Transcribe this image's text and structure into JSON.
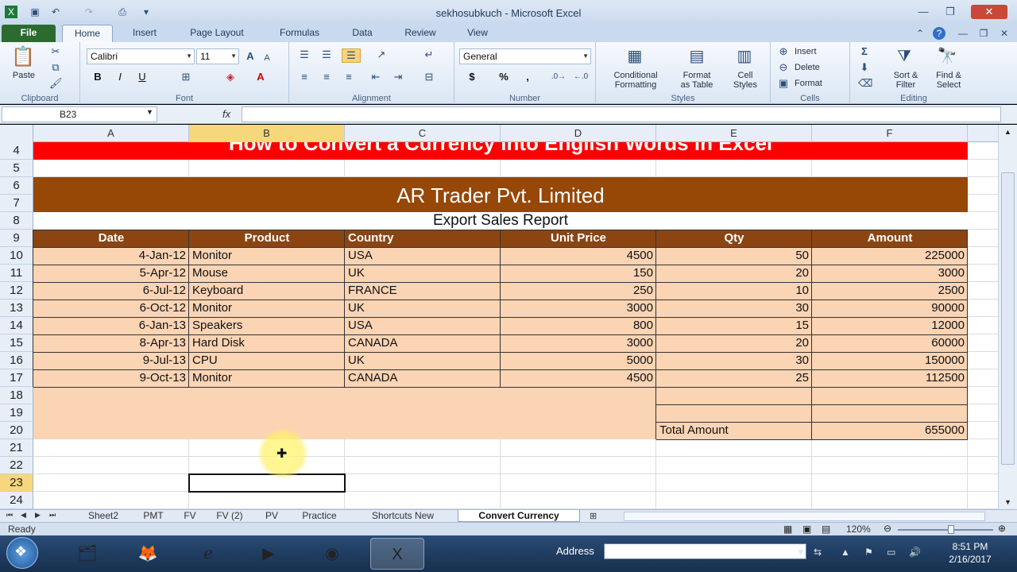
{
  "window": {
    "title": "sekhosubkuch - Microsoft Excel",
    "minimize_icon": "minimize-icon",
    "restore_icon": "restore-icon",
    "close_icon": "close-icon"
  },
  "tabs": [
    "File",
    "Home",
    "Insert",
    "Page Layout",
    "Formulas",
    "Data",
    "Review",
    "View"
  ],
  "ribbon": {
    "clipboard": {
      "label": "Clipboard",
      "paste": "Paste"
    },
    "font": {
      "label": "Font",
      "name": "Calibri",
      "size": "11",
      "bold": "B",
      "italic": "I",
      "underline": "U"
    },
    "alignment": {
      "label": "Alignment"
    },
    "number": {
      "label": "Number",
      "format": "General",
      "currency": "$",
      "percent": "%",
      "comma": ","
    },
    "styles": {
      "label": "Styles",
      "conditional_1": "Conditional",
      "conditional_2": "Formatting",
      "format_table_1": "Format",
      "format_table_2": "as Table",
      "cell_styles_1": "Cell",
      "cell_styles_2": "Styles"
    },
    "cells": {
      "label": "Cells",
      "insert": "Insert",
      "delete": "Delete",
      "format": "Format"
    },
    "editing": {
      "label": "Editing",
      "sort_1": "Sort &",
      "sort_2": "Filter",
      "find_1": "Find &",
      "find_2": "Select"
    }
  },
  "formula_bar": {
    "name_box": "B23",
    "fx": "fx",
    "formula": ""
  },
  "columns": [
    "A",
    "B",
    "C",
    "D",
    "E",
    "F"
  ],
  "rows": [
    "4",
    "5",
    "6",
    "7",
    "8",
    "9",
    "10",
    "11",
    "12",
    "13",
    "14",
    "15",
    "16",
    "17",
    "18",
    "19",
    "20",
    "21",
    "22",
    "23",
    "24"
  ],
  "sheet": {
    "banner": "How to Convert a Currency into English Words in Excel",
    "company": "AR Trader Pvt. Limited",
    "report": "Export Sales Report",
    "headers": [
      "Date",
      "Product",
      "Country",
      "Unit Price",
      "Qty",
      "Amount"
    ],
    "data": [
      [
        "4-Jan-12",
        "Monitor",
        "USA",
        "4500",
        "50",
        "225000"
      ],
      [
        "5-Apr-12",
        "Mouse",
        "UK",
        "150",
        "20",
        "3000"
      ],
      [
        "6-Jul-12",
        "Keyboard",
        "FRANCE",
        "250",
        "10",
        "2500"
      ],
      [
        "6-Oct-12",
        "Monitor",
        "UK",
        "3000",
        "30",
        "90000"
      ],
      [
        "6-Jan-13",
        "Speakers",
        "USA",
        "800",
        "15",
        "12000"
      ],
      [
        "8-Apr-13",
        "Hard Disk",
        "CANADA",
        "3000",
        "20",
        "60000"
      ],
      [
        "9-Jul-13",
        "CPU",
        "UK",
        "5000",
        "30",
        "150000"
      ],
      [
        "9-Oct-13",
        "Monitor",
        "CANADA",
        "4500",
        "25",
        "112500"
      ]
    ],
    "total_label": "Total Amount",
    "total_value": "655000"
  },
  "sheet_tabs": [
    "Sheet2",
    "PMT",
    "FV",
    "FV (2)",
    "PV",
    "Practice",
    "Shortcuts New",
    "Convert Currency"
  ],
  "active_sheet": "Convert Currency",
  "status": {
    "ready": "Ready",
    "zoom": "120%"
  },
  "taskbar": {
    "address_label": "Address",
    "time": "8:51 PM",
    "date": "2/16/2017"
  },
  "colors": {
    "banner_red": "#ff0000",
    "brown": "#974706",
    "header_brown": "#8b4513",
    "peach": "#fbd4b4",
    "file_tab_green": "#2b6b2f"
  }
}
